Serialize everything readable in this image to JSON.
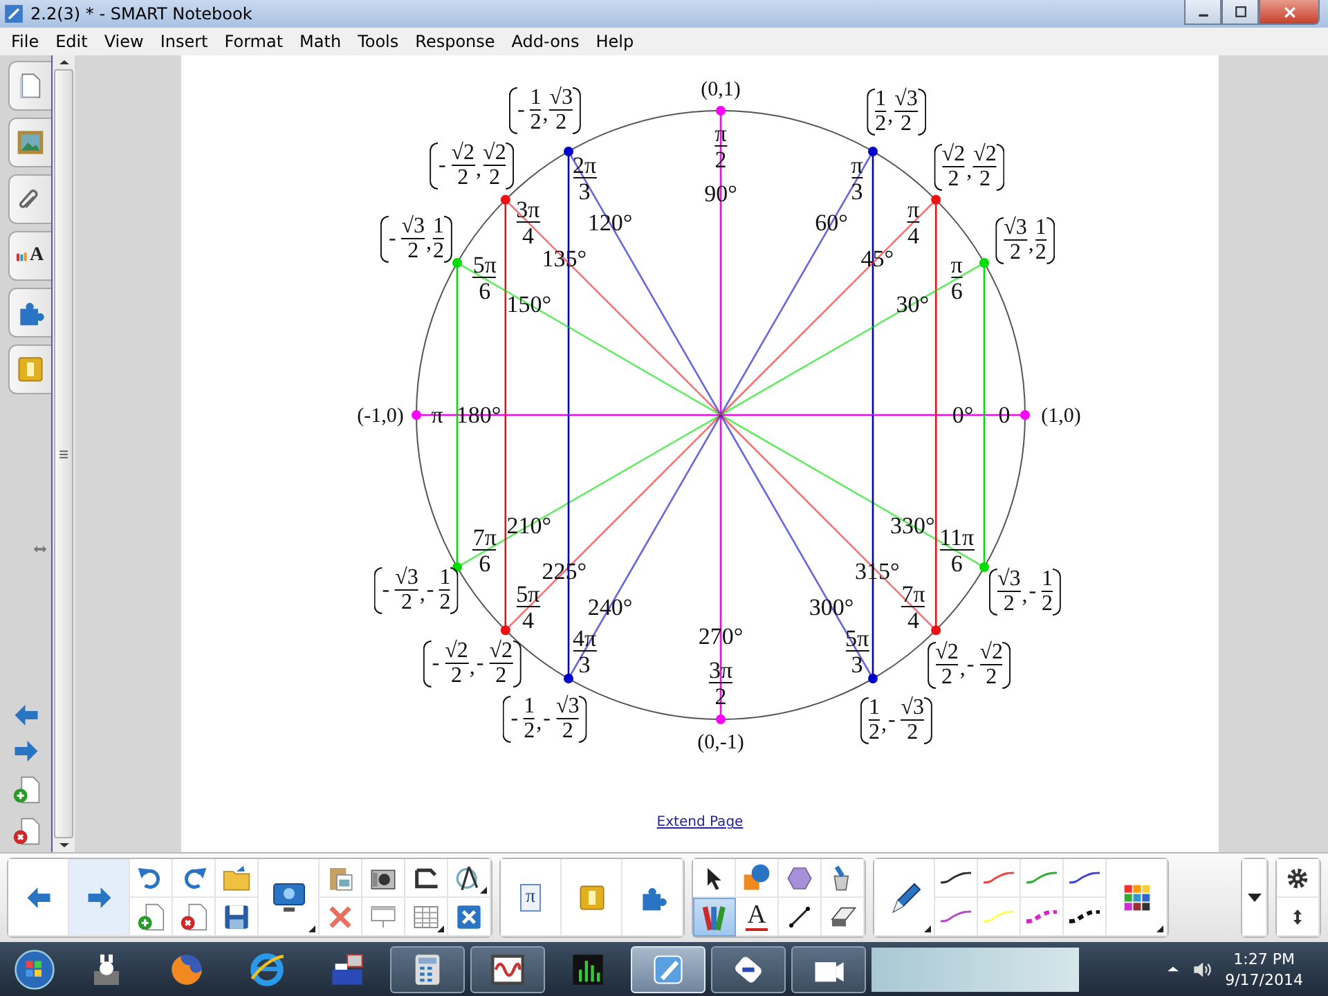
{
  "window": {
    "title": "2.2(3) * - SMART Notebook"
  },
  "menu": [
    "File",
    "Edit",
    "View",
    "Insert",
    "Format",
    "Math",
    "Tools",
    "Response",
    "Add-ons",
    "Help"
  ],
  "sidebar": {
    "properties_glyph": "A"
  },
  "page": {
    "unit_circle": {
      "points": [
        {
          "color": "#0000cc",
          "coordinate": {
            "kind": "fraction",
            "x": {
              "sign": "-",
              "num": "1",
              "den": "2"
            },
            "separator": ",",
            "y": {
              "num": "√3",
              "den": "2"
            }
          },
          "radian": {
            "num": "2π",
            "den": "3"
          },
          "degrees": "120°"
        },
        {
          "color": "#ff00ff",
          "coordinate": {
            "kind": "plain",
            "text": "(0,1)"
          },
          "radian": {
            "num": "π",
            "den": "2"
          },
          "degrees": "90°"
        },
        {
          "color": "#0000cc",
          "coordinate": {
            "kind": "fraction",
            "x": {
              "num": "1",
              "den": "2"
            },
            "separator": ",",
            "y": {
              "num": "√3",
              "den": "2"
            }
          },
          "radian": {
            "num": "π",
            "den": "3"
          },
          "degrees": "60°"
        },
        {
          "color": "#ee1111",
          "coordinate": {
            "kind": "fraction",
            "x": {
              "sign": "-",
              "num": "√2",
              "den": "2"
            },
            "separator": ",",
            "y": {
              "num": "√2",
              "den": "2"
            }
          },
          "radian": {
            "num": "3π",
            "den": "4"
          },
          "degrees": "135°"
        },
        {
          "color": "#ee1111",
          "coordinate": {
            "kind": "fraction",
            "x": {
              "num": "√2",
              "den": "2"
            },
            "separator": ",",
            "y": {
              "num": "√2",
              "den": "2"
            }
          },
          "radian": {
            "num": "π",
            "den": "4"
          },
          "degrees": "45°"
        },
        {
          "color": "#00dd00",
          "coordinate": {
            "kind": "fraction",
            "x": {
              "sign": "-",
              "num": "√3",
              "den": "2"
            },
            "separator": ",",
            "y": {
              "num": "1",
              "den": "2"
            }
          },
          "radian": {
            "num": "5π",
            "den": "6"
          },
          "degrees": "150°"
        },
        {
          "color": "#00dd00",
          "coordinate": {
            "kind": "fraction",
            "x": {
              "num": "√3",
              "den": "2"
            },
            "separator": ",",
            "y": {
              "num": "1",
              "den": "2"
            }
          },
          "radian": {
            "num": "π",
            "den": "6"
          },
          "degrees": "30°"
        },
        {
          "color": "#ff00ff",
          "coordinate": {
            "kind": "plain",
            "text": "(-1,0)"
          },
          "radian": {
            "num": "π"
          },
          "degrees": "180°"
        },
        {
          "color": "#ff00ff",
          "coordinate": {
            "kind": "plain",
            "text": "(1,0)"
          },
          "radian": {
            "num": "0"
          },
          "degrees": "0°"
        },
        {
          "color": "#00dd00",
          "coordinate": {
            "kind": "fraction",
            "x": {
              "sign": "-",
              "num": "√3",
              "den": "2"
            },
            "separator": ",",
            "y": {
              "sign": "-",
              "num": "1",
              "den": "2"
            }
          },
          "radian": {
            "num": "7π",
            "den": "6"
          },
          "degrees": "210°"
        },
        {
          "color": "#00dd00",
          "coordinate": {
            "kind": "fraction",
            "x": {
              "num": "√3",
              "den": "2"
            },
            "separator": ",",
            "y": {
              "sign": "-",
              "num": "1",
              "den": "2"
            }
          },
          "radian": {
            "num": "11π",
            "den": "6"
          },
          "degrees": "330°"
        },
        {
          "color": "#ee1111",
          "coordinate": {
            "kind": "fraction",
            "x": {
              "sign": "-",
              "num": "√2",
              "den": "2"
            },
            "separator": ",",
            "y": {
              "sign": "-",
              "num": "√2",
              "den": "2"
            }
          },
          "radian": {
            "num": "5π",
            "den": "4"
          },
          "degrees": "225°"
        },
        {
          "color": "#ee1111",
          "coordinate": {
            "kind": "fraction",
            "x": {
              "num": "√2",
              "den": "2"
            },
            "separator": ",",
            "y": {
              "sign": "-",
              "num": "√2",
              "den": "2"
            }
          },
          "radian": {
            "num": "7π",
            "den": "4"
          },
          "degrees": "315°"
        },
        {
          "color": "#0000cc",
          "coordinate": {
            "kind": "fraction",
            "x": {
              "sign": "-",
              "num": "1",
              "den": "2"
            },
            "separator": ",",
            "y": {
              "sign": "-",
              "num": "√3",
              "den": "2"
            }
          },
          "radian": {
            "num": "4π",
            "den": "3"
          },
          "degrees": "240°"
        },
        {
          "color": "#ff00ff",
          "coordinate": {
            "kind": "plain",
            "text": "(0,-1)"
          },
          "radian": {
            "num": "3π",
            "den": "2"
          },
          "degrees": "270°"
        },
        {
          "color": "#0000cc",
          "coordinate": {
            "kind": "fraction",
            "x": {
              "num": "1",
              "den": "2"
            },
            "separator": ",",
            "y": {
              "sign": "-",
              "num": "√3",
              "den": "2"
            }
          },
          "radian": {
            "num": "5π",
            "den": "3"
          },
          "degrees": "300°"
        }
      ]
    },
    "extend_link": "Extend Page"
  },
  "toolbar": {
    "math_glyph": "π",
    "text_tool_glyph": "A",
    "drawing_tools": [
      {
        "selected": false
      },
      {
        "selected": false
      },
      {
        "selected": false
      },
      {
        "selected": false
      },
      {
        "selected": true
      },
      {
        "selected": false
      },
      {
        "selected": false
      },
      {
        "selected": false
      }
    ],
    "pen_styles": [
      {
        "color": "#333333",
        "kind": "solid"
      },
      {
        "color": "#ee4444",
        "kind": "solid"
      },
      {
        "color": "#33aa33",
        "kind": "solid"
      },
      {
        "color": "#4444dd",
        "kind": "solid"
      },
      {
        "color": "#bb44cc",
        "kind": "solid"
      },
      {
        "color": "#ffff55",
        "kind": "solid"
      },
      {
        "color": "#dd22cc",
        "kind": "dashed"
      },
      {
        "color": "#111111",
        "kind": "dashed"
      }
    ]
  },
  "taskbar": {
    "apps": [
      {
        "running": false,
        "active": false
      },
      {
        "running": false,
        "active": false
      },
      {
        "running": false,
        "active": false
      },
      {
        "running": false,
        "active": false
      },
      {
        "running": true,
        "active": false
      },
      {
        "running": true,
        "active": false
      },
      {
        "running": false,
        "active": false
      },
      {
        "running": true,
        "active": true
      },
      {
        "running": true,
        "active": false
      },
      {
        "running": true,
        "active": false
      }
    ],
    "time": "1:27 PM",
    "date": "9/17/2014"
  }
}
